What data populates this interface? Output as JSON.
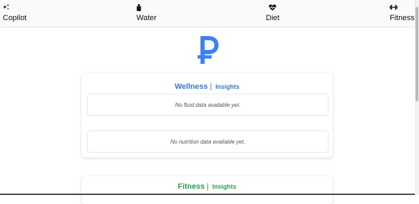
{
  "nav": {
    "items": [
      {
        "label": "Copilot",
        "icon": "sparkles-icon"
      },
      {
        "label": "Water",
        "icon": "bottle-icon"
      },
      {
        "label": "Diet",
        "icon": "heart-pulse-icon"
      },
      {
        "label": "Fitness",
        "icon": "dumbbell-icon"
      }
    ]
  },
  "logo": {
    "icon": "ruble-icon",
    "color": "#3b82f6"
  },
  "wellness": {
    "title": "Wellness",
    "separator": "|",
    "insights": "Insights",
    "fluid_empty": "No fluid data available yet.",
    "nutrition_empty": "No nutrition data available yet.",
    "color": "#3a76c4"
  },
  "fitness": {
    "title": "Fitness",
    "separator": "|",
    "insights": "Insights",
    "color": "#22a24b"
  }
}
